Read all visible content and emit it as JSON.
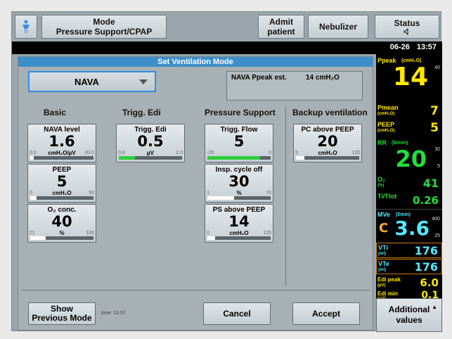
{
  "topbar": {
    "mode_label": "Mode",
    "mode_value": "Pressure Support/CPAP",
    "admit_line1": "Admit",
    "admit_line2": "patient",
    "nebulizer": "Nebulizer",
    "status": "Status",
    "status_icon": "speaker-icon"
  },
  "clock": {
    "date": "06-26",
    "time": "13:57"
  },
  "panel": {
    "title": "Set Ventilation Mode",
    "mode_select": "NAVA",
    "estimate_label": "NAVA Ppeak est.",
    "estimate_value": "14 cmH₂O",
    "col_basic": "Basic",
    "col_trigg": "Trigg. Edi",
    "col_ps": "Pressure Support",
    "col_backup": "Backup ventilation"
  },
  "params": [
    {
      "label": "NAVA level",
      "value": "1.6",
      "unit": "cmH₂O/µV",
      "min": "0.0",
      "max": "30.0",
      "fill": 0.05,
      "color": "white"
    },
    {
      "label": "PEEP",
      "value": "5",
      "unit": "cmH₂O",
      "min": "0",
      "max": "50",
      "fill": 0.1,
      "color": "white"
    },
    {
      "label": "O₂ conc.",
      "value": "40",
      "unit": "%",
      "min": "21",
      "max": "100",
      "fill": 0.24,
      "color": "white"
    },
    {
      "label": "Trigg. Edi",
      "value": "0.5",
      "unit": "µV",
      "min": "0.0",
      "max": "2.0",
      "fill": 0.25,
      "color": "green"
    },
    {
      "label": "Trigg. Flow",
      "value": "5",
      "unit": "",
      "min": "-20",
      "max": "0",
      "fill": 0.83,
      "color": "green"
    },
    {
      "label": "Insp. cycle off",
      "value": "30",
      "unit": "%",
      "min": "1",
      "max": "70",
      "fill": 0.42,
      "color": "white"
    },
    {
      "label": "PS above PEEP",
      "value": "14",
      "unit": "cmH₂O",
      "min": "0",
      "max": "120",
      "fill": 0.12,
      "color": "white"
    },
    {
      "label": "PC above PEEP",
      "value": "20",
      "unit": "cmH₂O",
      "min": "5",
      "max": "120",
      "fill": 0.13,
      "color": "white"
    }
  ],
  "bottom": {
    "show_prev_1": "Show",
    "show_prev_2": "Previous Mode",
    "time_note": "time: 13:57",
    "cancel": "Cancel",
    "accept": "Accept"
  },
  "monitor": {
    "ppeak_label": "Ppeak",
    "ppeak_unit": "(cmH₂O)",
    "ppeak_value": "14",
    "ppeak_max": "40",
    "pmean_label": "Pmean",
    "pmean_unit": "(cmH₂O)",
    "pmean_value": "7",
    "peep_label": "PEEP",
    "peep_unit": "(cmH₂O)",
    "peep_value": "5",
    "rr_label": "RR",
    "rr_unit": "(b/min)",
    "rr_value": "20",
    "rr_max": "30",
    "rr_min": "5",
    "o2_label": "O₂",
    "o2_unit": "(%)",
    "o2_value": "41",
    "titot_label": "Ti/Ttot",
    "titot_value": "0.26",
    "mve_label": "MVe",
    "mve_unit": "(l/min)",
    "mve_value": "3.6",
    "mve_prefix": "C",
    "mve_max": "400",
    "mve_min": "25",
    "vti_label": "VTi",
    "vti_unit": "(ml)",
    "vti_value": "176",
    "vte_label": "VTe",
    "vte_unit": "(ml)",
    "vte_value": "176",
    "edipeak_label": "Edi peak",
    "edipeak_unit": "(µV)",
    "edipeak_value": "6.0",
    "edimin_label": "Edi min",
    "edimin_unit": "(µV)",
    "edimin_value": "0.1"
  },
  "additional": {
    "line1": "Additional",
    "line2": "values"
  },
  "colors": {
    "title_bar": "#3c8fc9",
    "yellow": "#ffe800",
    "green": "#22e03a",
    "cyan": "#54e8ff",
    "orange": "#ffb020"
  }
}
